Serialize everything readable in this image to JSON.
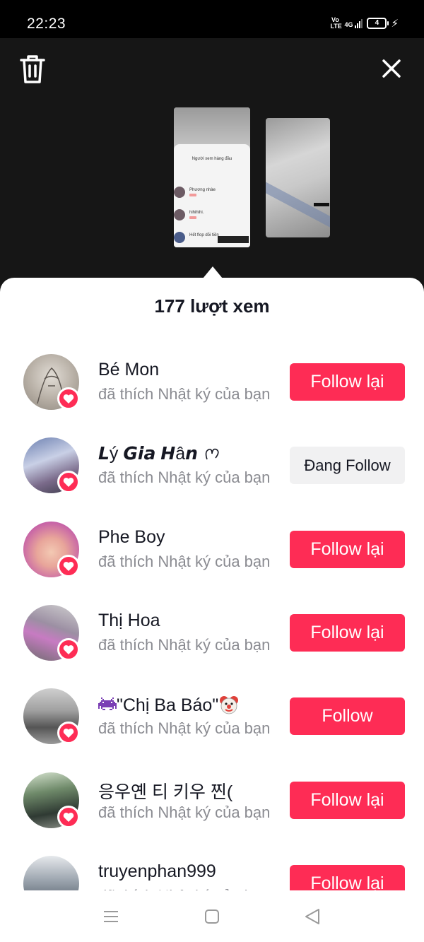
{
  "status_bar": {
    "time": "22:23",
    "volte": "Vo LTE",
    "network": "4G",
    "battery": "4"
  },
  "icons": {
    "trash": "trash-icon",
    "close": "close-icon",
    "heart": "heart-icon"
  },
  "preview": {
    "title": "Người xem hàng đầu",
    "rows": [
      "Phương nhàe",
      "hihihihi.",
      "Hết flop dõi tiền"
    ]
  },
  "viewers": {
    "count_label": "177 lượt xem"
  },
  "list": [
    {
      "username": "Bé Mon",
      "subtitle": "đã thích Nhật ký của bạn",
      "button": "Follow lại",
      "style": "primary"
    },
    {
      "username": "𝙇ý 𝙂𝙞𝙖 𝙃â𝙣",
      "subtitle": "đã thích Nhật ký của bạn",
      "button": "Đang Follow",
      "style": "secondary"
    },
    {
      "username": "Phe Boy",
      "subtitle": "đã thích Nhật ký của bạn",
      "button": "Follow lại",
      "style": "primary"
    },
    {
      "username": "Thị Hoa",
      "subtitle": "đã thích Nhật ký của bạn",
      "button": "Follow lại",
      "style": "primary"
    },
    {
      "username": "\"Chị Ba Báo\"",
      "subtitle": "đã thích Nhật ký của bạn",
      "button": "Follow",
      "style": "primary"
    },
    {
      "username": "응우옌 티 키우 찐(",
      "subtitle": "đã thích Nhật ký của bạn",
      "button": "Follow lại",
      "style": "primary"
    },
    {
      "username": "truyenphan999",
      "subtitle": "đã thích Nhật ký của bạn",
      "button": "Follow lại",
      "style": "primary"
    }
  ],
  "colors": {
    "accent": "#fe2c55",
    "secondary_button": "#f1f1f2",
    "text": "#161823",
    "muted": "#8a8b91",
    "dark_bg": "#161616"
  }
}
